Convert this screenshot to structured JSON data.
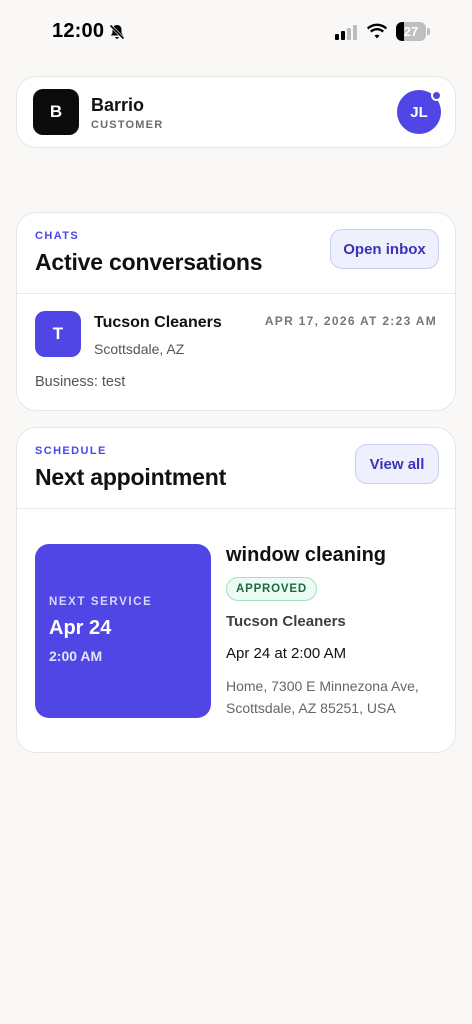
{
  "status_bar": {
    "time": "12:00",
    "battery_level": "27",
    "battery_fraction": 0.27,
    "icons": [
      "bell-slash-icon",
      "cellular-signal-icon",
      "wifi-icon",
      "battery-icon"
    ]
  },
  "header": {
    "logo_letter": "B",
    "brand_name": "Barrio",
    "role": "CUSTOMER",
    "avatar_initials": "JL"
  },
  "chats": {
    "section_label": "CHATS",
    "title": "Active conversations",
    "open_inbox_label": "Open inbox",
    "items": [
      {
        "avatar_letter": "T",
        "name": "Tucson Cleaners",
        "location": "Scottsdale, AZ",
        "timestamp": "APR 17, 2026 AT 2:23 AM",
        "preview": "Business: test"
      }
    ]
  },
  "schedule": {
    "section_label": "SCHEDULE",
    "title": "Next appointment",
    "view_all_label": "View all",
    "next": {
      "tile_label": "NEXT SERVICE",
      "tile_date": "Apr 24",
      "tile_time": "2:00 AM",
      "service": "window cleaning",
      "status": "APPROVED",
      "business": "Tucson Cleaners",
      "when": "Apr 24 at 2:00 AM",
      "address_line1": "Home, 7300 E Minnezona Ave,",
      "address_line2": "Scottsdale, AZ 85251, USA"
    }
  },
  "colors": {
    "accent": "#4f46e5",
    "background": "#f9f8f6",
    "approved_bg": "#ecfbf3",
    "approved_text": "#1b6b42"
  }
}
